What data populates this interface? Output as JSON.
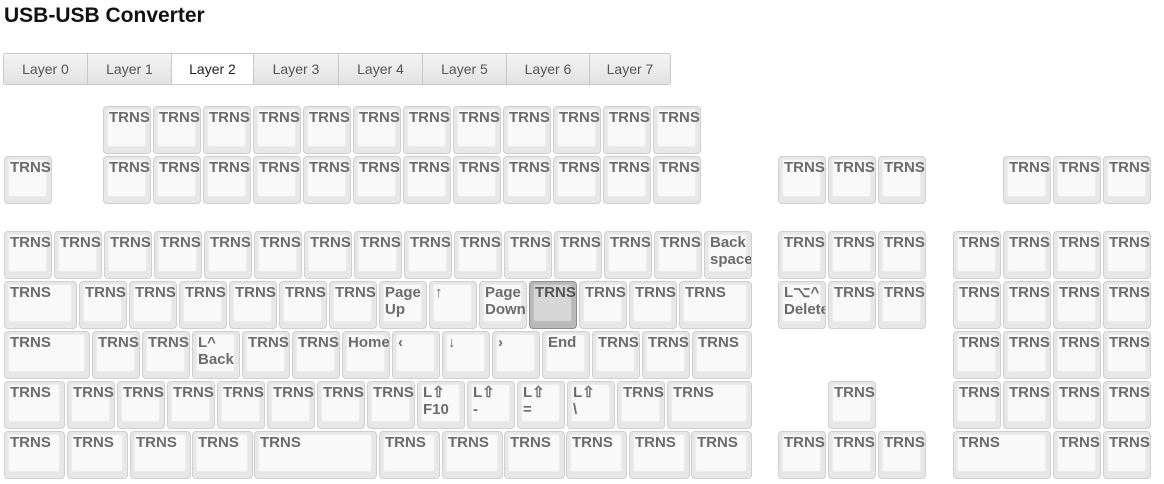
{
  "title": "USB-USB Converter",
  "tabs": [
    "Layer 0",
    "Layer 1",
    "Layer 2",
    "Layer 3",
    "Layer 4",
    "Layer 5",
    "Layer 6",
    "Layer 7"
  ],
  "active_tab": "Layer 2",
  "keyboard": {
    "rows": [
      {
        "keys": [
          {
            "label": "TRNS"
          },
          {
            "label": "TRNS"
          },
          {
            "label": "TRNS"
          },
          {
            "label": "TRNS"
          },
          {
            "label": "TRNS"
          },
          {
            "label": "TRNS"
          },
          {
            "label": "TRNS"
          },
          {
            "label": "TRNS"
          },
          {
            "label": "TRNS"
          },
          {
            "label": "TRNS"
          },
          {
            "label": "TRNS"
          },
          {
            "label": "TRNS"
          }
        ]
      },
      {
        "keys": [
          {
            "label": "TRNS"
          },
          {
            "label": "TRNS"
          },
          {
            "label": "TRNS"
          },
          {
            "label": "TRNS"
          },
          {
            "label": "TRNS"
          },
          {
            "label": "TRNS"
          },
          {
            "label": "TRNS"
          },
          {
            "label": "TRNS"
          },
          {
            "label": "TRNS"
          },
          {
            "label": "TRNS"
          },
          {
            "label": "TRNS"
          },
          {
            "label": "TRNS"
          },
          {
            "label": "TRNS"
          },
          {
            "label": "TRNS"
          },
          {
            "label": "TRNS"
          },
          {
            "label": "TRNS"
          },
          {
            "label": "TRNS"
          },
          {
            "label": "TRNS"
          },
          {
            "label": "TRNS"
          }
        ]
      },
      {
        "keys": [
          {
            "label": "TRNS"
          },
          {
            "label": "TRNS"
          },
          {
            "label": "TRNS"
          },
          {
            "label": "TRNS"
          },
          {
            "label": "TRNS"
          },
          {
            "label": "TRNS"
          },
          {
            "label": "TRNS"
          },
          {
            "label": "TRNS"
          },
          {
            "label": "TRNS"
          },
          {
            "label": "TRNS"
          },
          {
            "label": "TRNS"
          },
          {
            "label": "TRNS"
          },
          {
            "label": "TRNS"
          },
          {
            "label": "TRNS"
          },
          {
            "label": "Back\nspace"
          },
          {
            "label": "TRNS"
          },
          {
            "label": "TRNS"
          },
          {
            "label": "TRNS"
          },
          {
            "label": "TRNS"
          },
          {
            "label": "TRNS"
          },
          {
            "label": "TRNS"
          },
          {
            "label": "TRNS"
          }
        ]
      },
      {
        "keys": [
          {
            "label": "TRNS"
          },
          {
            "label": "TRNS"
          },
          {
            "label": "TRNS"
          },
          {
            "label": "TRNS"
          },
          {
            "label": "TRNS"
          },
          {
            "label": "TRNS"
          },
          {
            "label": "TRNS"
          },
          {
            "label": "Page\nUp"
          },
          {
            "label": "↑"
          },
          {
            "label": "Page\nDown"
          },
          {
            "label": "TRNS",
            "highlight": true
          },
          {
            "label": "TRNS"
          },
          {
            "label": "TRNS"
          },
          {
            "label": "TRNS"
          },
          {
            "label": "L⌥^\nDelete"
          },
          {
            "label": "TRNS"
          },
          {
            "label": "TRNS"
          },
          {
            "label": "TRNS"
          },
          {
            "label": "TRNS"
          },
          {
            "label": "TRNS"
          },
          {
            "label": "TRNS"
          }
        ]
      },
      {
        "keys": [
          {
            "label": "TRNS"
          },
          {
            "label": "TRNS"
          },
          {
            "label": "TRNS"
          },
          {
            "label": "L^\nBack"
          },
          {
            "label": "TRNS"
          },
          {
            "label": "TRNS"
          },
          {
            "label": "Home"
          },
          {
            "label": "‹"
          },
          {
            "label": "↓"
          },
          {
            "label": "›"
          },
          {
            "label": "End"
          },
          {
            "label": "TRNS"
          },
          {
            "label": "TRNS"
          },
          {
            "label": "TRNS"
          },
          {
            "label": "TRNS"
          },
          {
            "label": "TRNS"
          },
          {
            "label": "TRNS"
          },
          {
            "label": "TRNS"
          }
        ]
      },
      {
        "keys": [
          {
            "label": "TRNS"
          },
          {
            "label": "TRNS"
          },
          {
            "label": "TRNS"
          },
          {
            "label": "TRNS"
          },
          {
            "label": "TRNS"
          },
          {
            "label": "TRNS"
          },
          {
            "label": "TRNS"
          },
          {
            "label": "TRNS"
          },
          {
            "label": "L⇧\nF10"
          },
          {
            "label": "L⇧\n-"
          },
          {
            "label": "L⇧\n="
          },
          {
            "label": "L⇧\n\\"
          },
          {
            "label": "TRNS"
          },
          {
            "label": "TRNS"
          },
          {
            "label": "TRNS"
          },
          {
            "label": "TRNS"
          },
          {
            "label": "TRNS"
          },
          {
            "label": "TRNS"
          },
          {
            "label": "TRNS"
          }
        ]
      },
      {
        "keys": [
          {
            "label": "TRNS"
          },
          {
            "label": "TRNS"
          },
          {
            "label": "TRNS"
          },
          {
            "label": "TRNS"
          },
          {
            "label": "TRNS"
          },
          {
            "label": "TRNS"
          },
          {
            "label": "TRNS"
          },
          {
            "label": "TRNS"
          },
          {
            "label": "TRNS"
          },
          {
            "label": "TRNS"
          },
          {
            "label": "TRNS"
          },
          {
            "label": "TRNS"
          },
          {
            "label": "TRNS"
          },
          {
            "label": "TRNS"
          },
          {
            "label": "TRNS"
          },
          {
            "label": "TRNS"
          },
          {
            "label": "TRNS"
          }
        ]
      }
    ]
  }
}
